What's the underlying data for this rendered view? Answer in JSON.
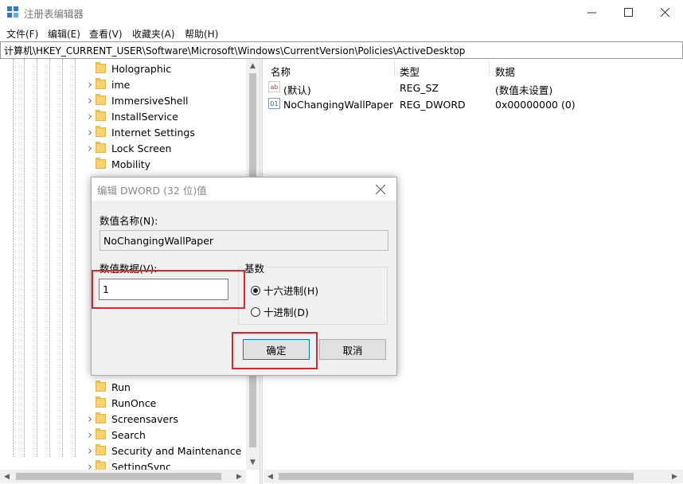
{
  "window": {
    "title": "注册表编辑器",
    "icon": "regedit-icon"
  },
  "menu": [
    "文件(F)",
    "编辑(E)",
    "查看(V)",
    "收藏夹(A)",
    "帮助(H)"
  ],
  "address": "计算机\\HKEY_CURRENT_USER\\Software\\Microsoft\\Windows\\CurrentVersion\\Policies\\ActiveDesktop",
  "tree": {
    "items_top": [
      {
        "label": "Holographic",
        "expandable": false
      },
      {
        "label": "ime",
        "expandable": true
      },
      {
        "label": "ImmersiveShell",
        "expandable": true
      },
      {
        "label": "InstallService",
        "expandable": true
      },
      {
        "label": "Internet Settings",
        "expandable": true
      },
      {
        "label": "Lock Screen",
        "expandable": true
      },
      {
        "label": "Mobility",
        "expandable": false
      }
    ],
    "items_bottom": [
      {
        "label": "Run",
        "expandable": false
      },
      {
        "label": "RunOnce",
        "expandable": false
      },
      {
        "label": "Screensavers",
        "expandable": true
      },
      {
        "label": "Search",
        "expandable": true
      },
      {
        "label": "Security and Maintenance",
        "expandable": true
      },
      {
        "label": "SettingSync",
        "expandable": true
      }
    ]
  },
  "list": {
    "columns": [
      "名称",
      "类型",
      "数据"
    ],
    "rows": [
      {
        "name": "(默认)",
        "type": "REG_SZ",
        "data": "(数值未设置)",
        "icon": "string-value-icon"
      },
      {
        "name": "NoChangingWallPaper",
        "type": "REG_DWORD",
        "data": "0x00000000 (0)",
        "icon": "binary-value-icon"
      }
    ]
  },
  "dialog": {
    "title": "编辑 DWORD (32 位)值",
    "name_label": "数值名称(N):",
    "name_value": "NoChangingWallPaper",
    "data_label": "数值数据(V):",
    "data_value": "1",
    "base_label": "基数",
    "radio_hex": "十六进制(H)",
    "radio_dec": "十进制(D)",
    "selected_base": "hex",
    "ok": "确定",
    "cancel": "取消"
  },
  "colors": {
    "highlight": "#e0242b",
    "folder": "#f6d370"
  }
}
